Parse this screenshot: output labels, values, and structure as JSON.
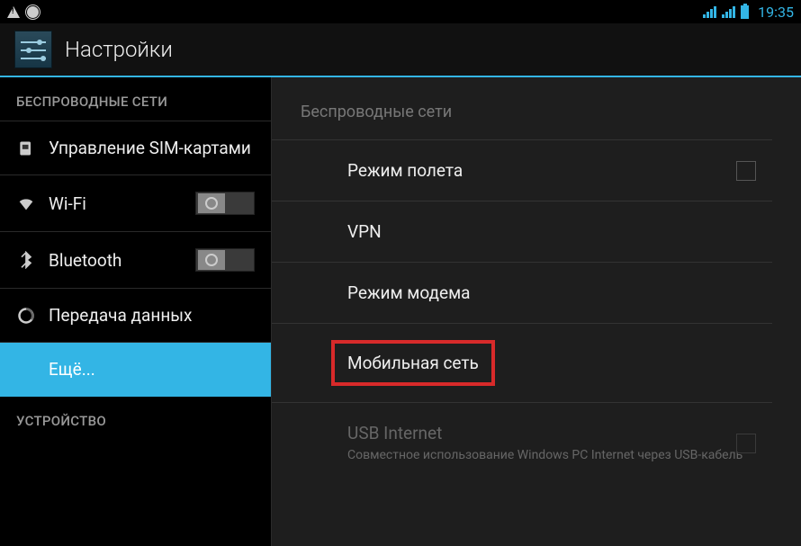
{
  "status": {
    "time": "19:35"
  },
  "title": "Настройки",
  "sidebar": {
    "section_wireless": "БЕСПРОВОДНЫЕ СЕТИ",
    "section_device": "УСТРОЙСТВО",
    "items": {
      "sim": "Управление SIM-картами",
      "wifi": "Wi-Fi",
      "bluetooth": "Bluetooth",
      "data": "Передача данных",
      "more": "Ещё..."
    }
  },
  "panel": {
    "header": "Беспроводные сети",
    "airplane": "Режим полета",
    "vpn": "VPN",
    "tether": "Режим модема",
    "mobile": "Мобильная сеть",
    "usb": {
      "title": "USB Internet",
      "sub": "Совместное использование Windows PC Internet через USB-кабель"
    }
  }
}
